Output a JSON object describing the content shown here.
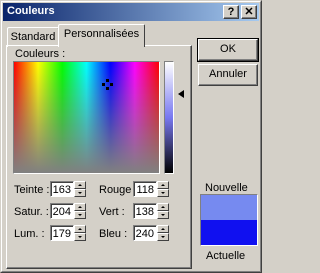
{
  "window": {
    "title": "Couleurs",
    "help_glyph": "?",
    "close_glyph": "✕"
  },
  "tabs": [
    {
      "label": "Standard",
      "selected": false
    },
    {
      "label": "Personnalisées",
      "selected": true
    }
  ],
  "picker": {
    "label": "Couleurs :",
    "icons": {
      "crosshair": "crosshair-icon",
      "luminosity_arrow": "triangle-left-icon"
    }
  },
  "fields": {
    "teinte": {
      "label": "Teinte :",
      "value": "163"
    },
    "satur": {
      "label": "Satur. :",
      "value": "204"
    },
    "lum": {
      "label": "Lum. :",
      "value": "179"
    },
    "rouge": {
      "label": "Rouge :",
      "value": "118"
    },
    "vert": {
      "label": "Vert :",
      "value": "138"
    },
    "bleu": {
      "label": "Bleu :",
      "value": "240"
    }
  },
  "buttons": {
    "ok": "OK",
    "cancel": "Annuler"
  },
  "preview": {
    "new_label": "Nouvelle",
    "current_label": "Actuelle",
    "new_color": "#768af0",
    "current_color": "#1010f0"
  },
  "colors": {
    "titlebar_start": "#0a246a",
    "titlebar_end": "#a6caf0",
    "face": "#d4d0c8"
  }
}
